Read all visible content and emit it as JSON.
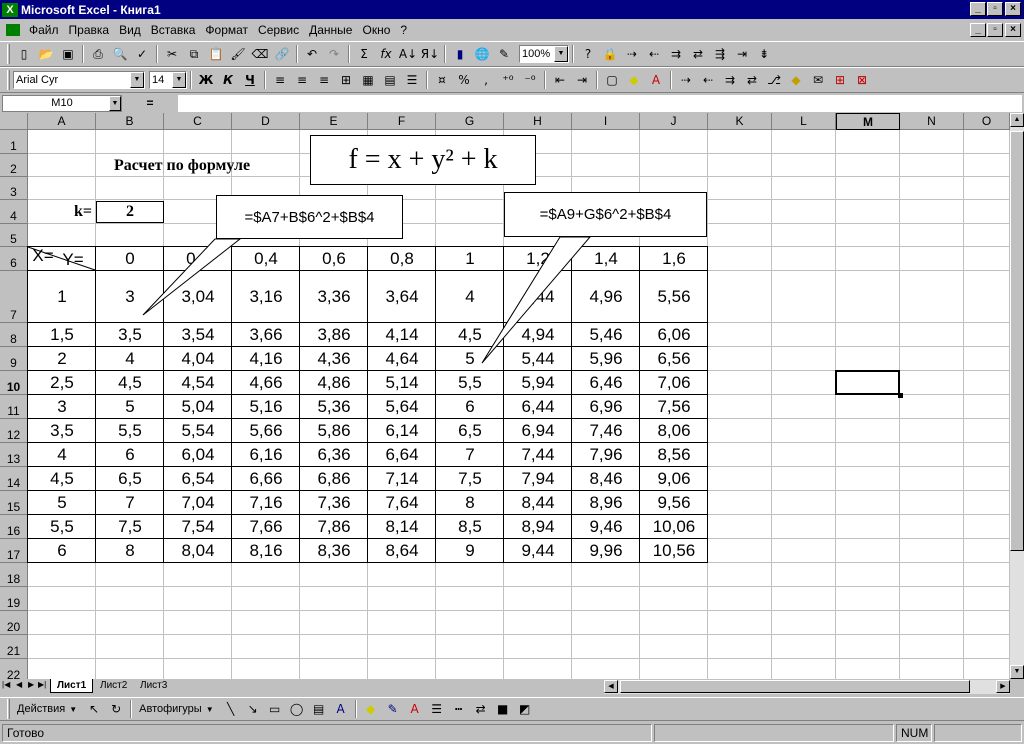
{
  "window": {
    "title": "Microsoft Excel - Книга1"
  },
  "menu": [
    "Файл",
    "Правка",
    "Вид",
    "Вставка",
    "Формат",
    "Сервис",
    "Данные",
    "Окно",
    "?"
  ],
  "toolbar": {
    "zoom": "100%"
  },
  "format_toolbar": {
    "font": "Arial Cyr",
    "size": "14",
    "bold": "Ж",
    "italic": "К",
    "underline": "Ч"
  },
  "formula_bar": {
    "name_box": "M10",
    "eq": "="
  },
  "columns": [
    "A",
    "B",
    "C",
    "D",
    "E",
    "F",
    "G",
    "H",
    "I",
    "J",
    "K",
    "L",
    "M",
    "N",
    "O"
  ],
  "rows": [
    "1",
    "2",
    "3",
    "4",
    "5",
    "6",
    "7",
    "8",
    "9",
    "10",
    "11",
    "12",
    "13",
    "14",
    "15",
    "16",
    "17",
    "18",
    "19",
    "20",
    "21",
    "22"
  ],
  "sheet": {
    "title": "Расчет по формуле",
    "formula": "f = x + y² + k",
    "k_label": "k=",
    "k_value": "2",
    "y_label": "Y=",
    "x_label": "X=",
    "y_values": [
      "0",
      "0,2",
      "0,4",
      "0,6",
      "0,8",
      "1",
      "1,2",
      "1,4",
      "1,6"
    ],
    "x_values": [
      "1",
      "1,5",
      "2",
      "2,5",
      "3",
      "3,5",
      "4",
      "4,5",
      "5",
      "5,5",
      "6"
    ],
    "table": [
      [
        "3",
        "3,04",
        "3,16",
        "3,36",
        "3,64",
        "4",
        "4,44",
        "4,96",
        "5,56"
      ],
      [
        "3,5",
        "3,54",
        "3,66",
        "3,86",
        "4,14",
        "4,5",
        "4,94",
        "5,46",
        "6,06"
      ],
      [
        "4",
        "4,04",
        "4,16",
        "4,36",
        "4,64",
        "5",
        "5,44",
        "5,96",
        "6,56"
      ],
      [
        "4,5",
        "4,54",
        "4,66",
        "4,86",
        "5,14",
        "5,5",
        "5,94",
        "6,46",
        "7,06"
      ],
      [
        "5",
        "5,04",
        "5,16",
        "5,36",
        "5,64",
        "6",
        "6,44",
        "6,96",
        "7,56"
      ],
      [
        "5,5",
        "5,54",
        "5,66",
        "5,86",
        "6,14",
        "6,5",
        "6,94",
        "7,46",
        "8,06"
      ],
      [
        "6",
        "6,04",
        "6,16",
        "6,36",
        "6,64",
        "7",
        "7,44",
        "7,96",
        "8,56"
      ],
      [
        "6,5",
        "6,54",
        "6,66",
        "6,86",
        "7,14",
        "7,5",
        "7,94",
        "8,46",
        "9,06"
      ],
      [
        "7",
        "7,04",
        "7,16",
        "7,36",
        "7,64",
        "8",
        "8,44",
        "8,96",
        "9,56"
      ],
      [
        "7,5",
        "7,54",
        "7,66",
        "7,86",
        "8,14",
        "8,5",
        "8,94",
        "9,46",
        "10,06"
      ],
      [
        "8",
        "8,04",
        "8,16",
        "8,36",
        "8,64",
        "9",
        "9,44",
        "9,96",
        "10,56"
      ]
    ],
    "callout1": "=$A7+B$6^2+$B$4",
    "callout2": "=$A9+G$6^2+$B$4"
  },
  "tabs": [
    "Лист1",
    "Лист2",
    "Лист3"
  ],
  "draw": {
    "actions": "Действия",
    "autoshapes": "Автофигуры"
  },
  "status": {
    "ready": "Готово",
    "num": "NUM"
  }
}
